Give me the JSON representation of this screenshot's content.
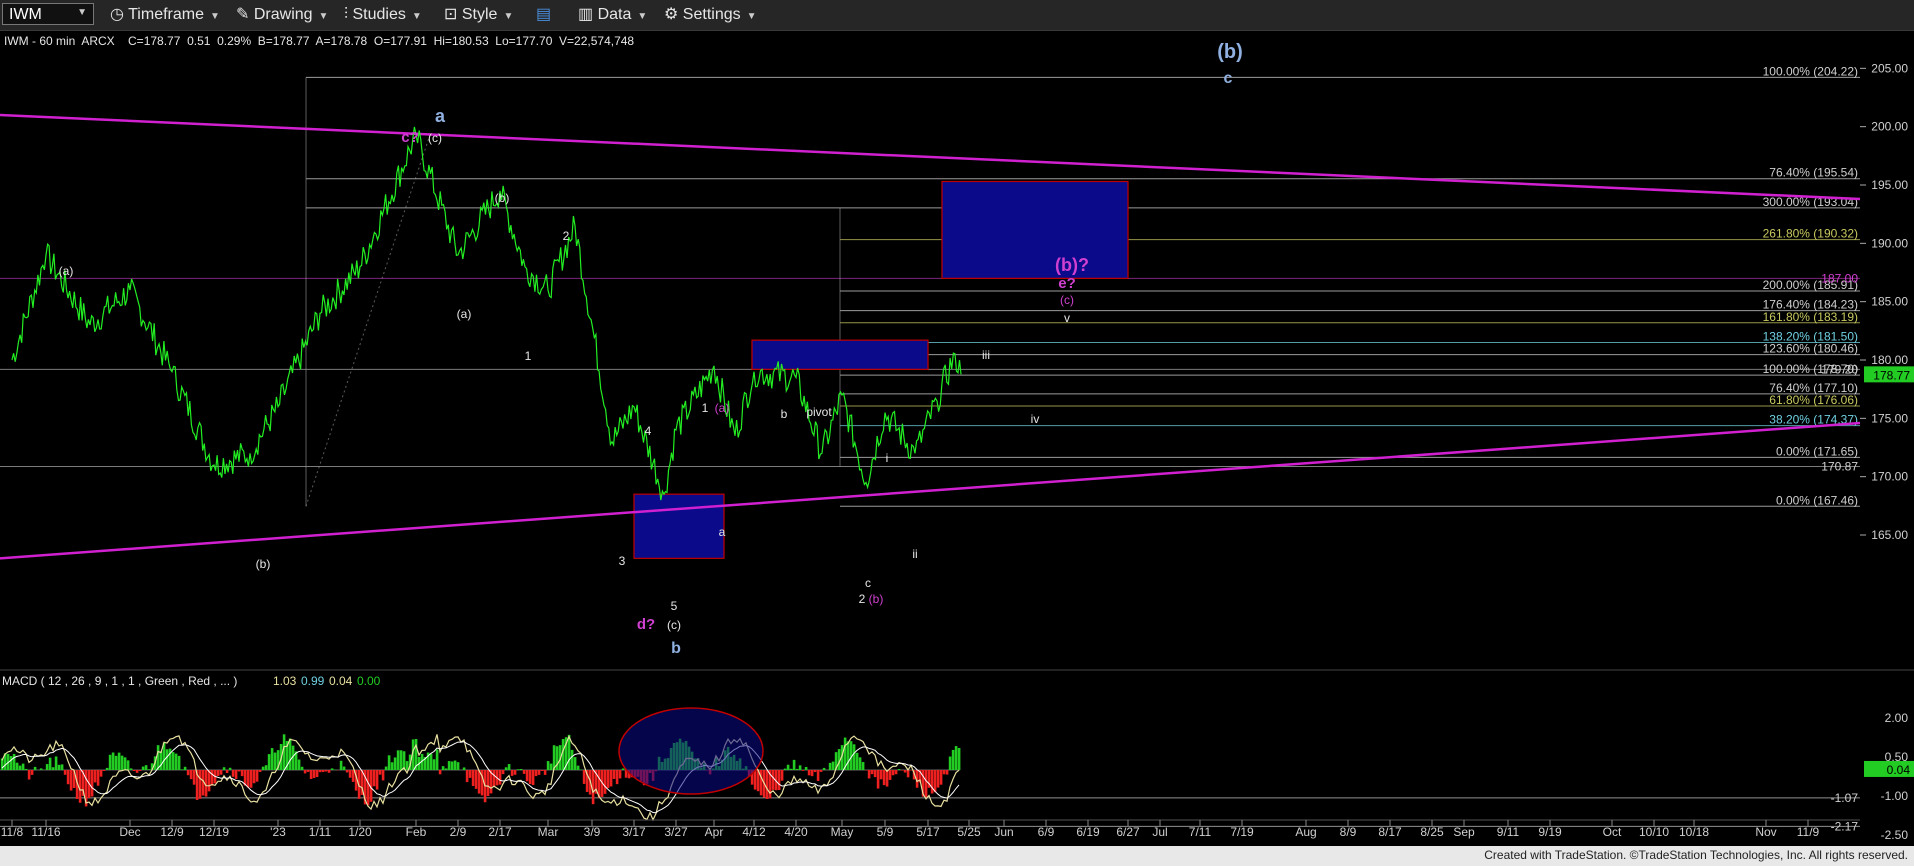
{
  "toolbar": {
    "symbol": "IWM",
    "items": [
      "Timeframe",
      "Drawing",
      "Studies",
      "Style",
      "Data",
      "Settings"
    ]
  },
  "header_line": "IWM - 60 min  ARCX    C=178.77  0.51  0.29%  B=178.77  A=178.78  O=177.91  Hi=180.53  Lo=177.70  V=22,574,748",
  "macd_header": "MACD ( 12 , 26 , 9 , 1 , 1 , Green , Red , ... )",
  "macd_values": [
    "1.03",
    "0.99",
    "0.04",
    "0.00"
  ],
  "footer": "Created with TradeStation. ©TradeStation Technologies, Inc. All rights reserved.",
  "colors": {
    "price": "#22ee22",
    "trendline": "#d020d0",
    "box_fill": "#0a0a8a",
    "box_border": "#c00000",
    "label_white": "#e6e6e6",
    "label_magenta": "#d040d0",
    "label_blue": "#8fb0e0",
    "macd_line": "#e8e0a0",
    "macd_signal": "#ffffff",
    "hist_pos": "#22cc22",
    "hist_neg": "#ee2020",
    "fib_white": "#cfcfcf",
    "fib_yellow": "#c8c860",
    "fib_cyan": "#6fd0e0"
  },
  "chart_data": [
    {
      "type": "line",
      "name": "price",
      "y_axis_ticks": [
        165,
        170,
        175,
        180,
        185,
        190,
        195,
        200,
        205
      ],
      "ylim": [
        162,
        207
      ],
      "x_axis_ticks": [
        "11/8",
        "11/16",
        "Dec",
        "12/9",
        "12/19",
        "'23",
        "1/11",
        "1/20",
        "Feb",
        "2/9",
        "2/17",
        "Mar",
        "3/9",
        "3/17",
        "3/27",
        "Apr",
        "4/12",
        "4/20",
        "May",
        "5/9",
        "5/17",
        "5/25",
        "Jun",
        "6/9",
        "6/19",
        "6/27",
        "Jul",
        "7/11",
        "7/19",
        "Aug",
        "8/9",
        "8/17",
        "8/25",
        "Sep",
        "9/11",
        "9/19",
        "Oct",
        "10/10",
        "10/18",
        "Nov",
        "11/9"
      ],
      "key_points": [
        {
          "date": "11/8",
          "value": 180
        },
        {
          "date": "11/16",
          "value": 189
        },
        {
          "date": "11/25",
          "value": 183
        },
        {
          "date": "Dec",
          "value": 186
        },
        {
          "date": "12/9",
          "value": 179
        },
        {
          "date": "12/19",
          "value": 171
        },
        {
          "date": "12/28",
          "value": 172
        },
        {
          "date": "'23",
          "value": 176
        },
        {
          "date": "1/11",
          "value": 184
        },
        {
          "date": "1/20",
          "value": 188
        },
        {
          "date": "Feb",
          "value": 199.3
        },
        {
          "date": "2/9",
          "value": 189
        },
        {
          "date": "2/17",
          "value": 194.5
        },
        {
          "date": "2/24",
          "value": 188
        },
        {
          "date": "Mar",
          "value": 186
        },
        {
          "date": "3/6",
          "value": 191.5
        },
        {
          "date": "3/13",
          "value": 173
        },
        {
          "date": "3/17",
          "value": 176
        },
        {
          "date": "3/24",
          "value": 168.5
        },
        {
          "date": "3/27",
          "value": 174
        },
        {
          "date": "Apr",
          "value": 179.5
        },
        {
          "date": "4/6",
          "value": 173.5
        },
        {
          "date": "4/12",
          "value": 179
        },
        {
          "date": "4/20",
          "value": 178.5
        },
        {
          "date": "4/28",
          "value": 172
        },
        {
          "date": "May",
          "value": 177
        },
        {
          "date": "5/4",
          "value": 169.5
        },
        {
          "date": "5/9",
          "value": 175.5
        },
        {
          "date": "5/15",
          "value": 172
        },
        {
          "date": "5/19",
          "value": 176.5
        },
        {
          "date": "5/23",
          "value": 180.53
        },
        {
          "date": "5/24",
          "value": 178.77
        }
      ],
      "last_price": 178.77,
      "last_price_label": "178.77",
      "fib_levels": [
        {
          "label": "100.00% (204.22)",
          "value": 204.22,
          "color": "fib_white"
        },
        {
          "label": "76.40% (195.54)",
          "value": 195.54,
          "color": "fib_white"
        },
        {
          "label": "300.00% (193.04)",
          "value": 193.04,
          "color": "fib_white"
        },
        {
          "label": "261.80% (190.32)",
          "value": 190.32,
          "color": "fib_yellow"
        },
        {
          "label": "200.00% (185.91)",
          "value": 185.91,
          "color": "fib_white"
        },
        {
          "label": "176.40% (184.23)",
          "value": 184.23,
          "color": "fib_white"
        },
        {
          "label": "161.80% (183.19)",
          "value": 183.19,
          "color": "fib_yellow"
        },
        {
          "label": "138.20% (181.50)",
          "value": 181.5,
          "color": "fib_cyan"
        },
        {
          "label": "123.60% (180.46)",
          "value": 180.46,
          "color": "fib_white"
        },
        {
          "label": "100.00% (178.70)",
          "value": 178.7,
          "color": "fib_white"
        },
        {
          "label": "76.40% (177.10)",
          "value": 177.1,
          "color": "fib_white"
        },
        {
          "label": "61.80% (176.06)",
          "value": 176.06,
          "color": "fib_yellow"
        },
        {
          "label": "38.20% (174.37)",
          "value": 174.37,
          "color": "fib_cyan"
        },
        {
          "label": "0.00% (171.65)",
          "value": 171.65,
          "color": "fib_white"
        },
        {
          "label": "0.00% (167.46)",
          "value": 167.46,
          "color": "fib_white"
        }
      ],
      "level_labels": [
        {
          "label": "187.00",
          "value": 187.0,
          "color": "label_magenta"
        },
        {
          "label": "179.20",
          "value": 179.2,
          "color": "fib_white"
        },
        {
          "label": "170.87",
          "value": 170.87,
          "color": "fib_white"
        }
      ],
      "trendlines": [
        {
          "from": {
            "date": "start",
            "value": 201
          },
          "to": {
            "date": "right edge",
            "value": 193.8
          }
        },
        {
          "from": {
            "date": "start",
            "value": 163
          },
          "to": {
            "date": "right edge",
            "value": 174.6
          }
        }
      ],
      "boxes": [
        {
          "label": "(b)? box",
          "from_date": "5/29",
          "to_date": "6/27",
          "from_value": 187,
          "to_value": 195.3
        },
        {
          "label": "pivot box",
          "from_date": "4/8",
          "to_date": "5/17",
          "from_value": 179.2,
          "to_value": 181.7
        },
        {
          "label": "b box",
          "from_date": "3/17",
          "to_date": "3/29",
          "from_value": 163,
          "to_value": 168.5
        }
      ],
      "annotations": [
        {
          "text": "(b)",
          "color": "label_blue"
        },
        {
          "text": "c",
          "color": "label_blue"
        },
        {
          "text": "a",
          "color": "label_blue"
        },
        {
          "text": "c?",
          "color": "label_magenta"
        },
        {
          "text": "(c)",
          "color": "label_white"
        },
        {
          "text": "(b)",
          "color": "label_white"
        },
        {
          "text": "2",
          "color": "label_white"
        },
        {
          "text": "(a)",
          "color": "label_white"
        },
        {
          "text": "(a)",
          "color": "label_white"
        },
        {
          "text": "1",
          "color": "label_white"
        },
        {
          "text": "(b)",
          "color": "label_white"
        },
        {
          "text": "(b)?",
          "color": "label_magenta"
        },
        {
          "text": "e?",
          "color": "label_magenta"
        },
        {
          "text": "(c)",
          "color": "label_magenta"
        },
        {
          "text": "v",
          "color": "label_white"
        },
        {
          "text": "iii",
          "color": "label_white"
        },
        {
          "text": "iv",
          "color": "label_white"
        },
        {
          "text": "pivot",
          "color": "label_white"
        },
        {
          "text": "b",
          "color": "label_white"
        },
        {
          "text": "1",
          "color": "label_white"
        },
        {
          "text": "(a)",
          "color": "label_magenta"
        },
        {
          "text": "4",
          "color": "label_white"
        },
        {
          "text": "a",
          "color": "label_white"
        },
        {
          "text": "3",
          "color": "label_white"
        },
        {
          "text": "5",
          "color": "label_white"
        },
        {
          "text": "d?",
          "color": "label_magenta"
        },
        {
          "text": "(c)",
          "color": "label_white"
        },
        {
          "text": "b",
          "color": "label_blue"
        },
        {
          "text": "i",
          "color": "label_white"
        },
        {
          "text": "ii",
          "color": "label_white"
        },
        {
          "text": "c",
          "color": "label_white"
        },
        {
          "text": "2",
          "color": "label_white"
        },
        {
          "text": "(b)",
          "color": "label_magenta"
        }
      ]
    },
    {
      "type": "line",
      "name": "MACD",
      "y_axis_ticks": [
        "2.00",
        "0.50",
        "-1.00",
        "-2.50"
      ],
      "ylim": [
        -3.0,
        3.0
      ],
      "price_labels": [
        {
          "label": "0.04",
          "value": 0.04
        },
        {
          "label": "-1.07",
          "value": -1.07
        },
        {
          "label": "-2.17",
          "value": -2.17
        }
      ],
      "annotations": [
        "ellipse around the March low of the MACD"
      ]
    }
  ]
}
